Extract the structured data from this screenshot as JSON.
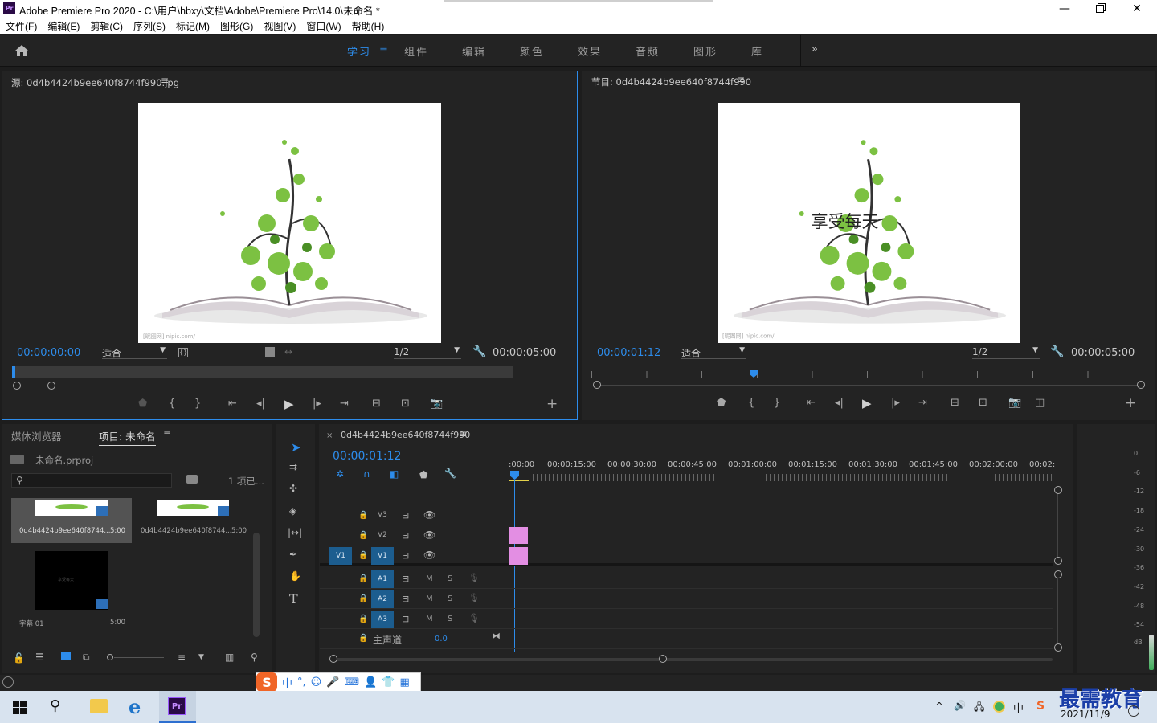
{
  "window": {
    "title": "Adobe Premiere Pro 2020 - C:\\用户\\hbxy\\文档\\Adobe\\Premiere Pro\\14.0\\未命名 *",
    "app_icon": "Pr"
  },
  "menu": [
    "文件(F)",
    "编辑(E)",
    "剪辑(C)",
    "序列(S)",
    "标记(M)",
    "图形(G)",
    "视图(V)",
    "窗口(W)",
    "帮助(H)"
  ],
  "workspaces": {
    "active": "学习",
    "items": [
      "组件",
      "编辑",
      "颜色",
      "效果",
      "音频",
      "图形",
      "库"
    ]
  },
  "source": {
    "title": "源: 0d4b4424b9ee640f8744f990.jpg",
    "timecode": "00:00:00:00",
    "fit": "适合",
    "res": "1/2",
    "duration": "00:00:05:00",
    "watermark": "[昵图网] nipic.com/"
  },
  "program": {
    "title": "节目: 0d4b4424b9ee640f8744f990",
    "timecode": "00:00:01:12",
    "fit": "适合",
    "res": "1/2",
    "duration": "00:00:05:00",
    "overlay_text": "享受每天",
    "watermark": "[昵图网] nipic.com/"
  },
  "project": {
    "tab_media": "媒体浏览器",
    "tab_project": "项目: 未命名",
    "file": "未命名.prproj",
    "count": "1 项已...",
    "items": [
      {
        "name": "0d4b4424b9ee640f8744...",
        "dur": "5:00"
      },
      {
        "name": "0d4b4424b9ee640f8744...",
        "dur": "5:00"
      },
      {
        "name": "字幕 01",
        "dur": "5:00",
        "thumb_text": "享受每天"
      }
    ]
  },
  "timeline": {
    "tab": "0d4b4424b9ee640f8744f990",
    "timecode": "00:00:01:12",
    "ruler": [
      ":00:00",
      "00:00:15:00",
      "00:00:30:00",
      "00:00:45:00",
      "00:01:00:00",
      "00:01:15:00",
      "00:01:30:00",
      "00:01:45:00",
      "00:02:00:00",
      "00:02:"
    ],
    "video_tracks": [
      "V3",
      "V2",
      "V1"
    ],
    "src_patch": "V1",
    "audio_tracks": [
      "A1",
      "A2",
      "A3"
    ],
    "mute": "M",
    "solo": "S",
    "master": "主声道",
    "master_val": "0.0",
    "clip_color": "#e38ee3"
  },
  "meter": {
    "labels": [
      "0",
      "-6",
      "-12",
      "-18",
      "-24",
      "-30",
      "-36",
      "-42",
      "-48",
      "-54",
      "dB"
    ]
  },
  "ime": {
    "brand": "S",
    "mode": "中"
  },
  "taskbar": {
    "date": "2021/11/9",
    "ime": "中",
    "watermark": "最需教育"
  }
}
